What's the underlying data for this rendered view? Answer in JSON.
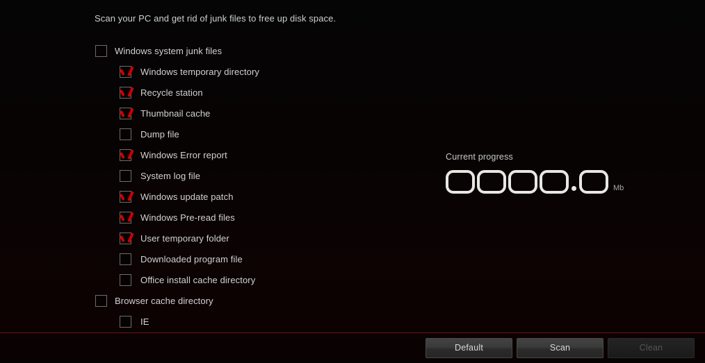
{
  "header": {
    "description": "Scan your PC and get rid of junk files to free up disk space."
  },
  "list": {
    "items": [
      {
        "label": "Windows system junk files",
        "level": 0,
        "checked": false
      },
      {
        "label": "Windows temporary directory",
        "level": 1,
        "checked": true
      },
      {
        "label": "Recycle station",
        "level": 1,
        "checked": true
      },
      {
        "label": "Thumbnail cache",
        "level": 1,
        "checked": true
      },
      {
        "label": "Dump file",
        "level": 1,
        "checked": false
      },
      {
        "label": "Windows Error report",
        "level": 1,
        "checked": true
      },
      {
        "label": "System log file",
        "level": 1,
        "checked": false
      },
      {
        "label": "Windows update patch",
        "level": 1,
        "checked": true
      },
      {
        "label": "Windows Pre-read files",
        "level": 1,
        "checked": true
      },
      {
        "label": "User temporary folder",
        "level": 1,
        "checked": true
      },
      {
        "label": "Downloaded program file",
        "level": 1,
        "checked": false
      },
      {
        "label": "Office install cache directory",
        "level": 1,
        "checked": false
      },
      {
        "label": "Browser cache directory",
        "level": 0,
        "checked": false
      },
      {
        "label": "IE",
        "level": 1,
        "checked": false
      }
    ]
  },
  "progress": {
    "title": "Current progress",
    "value": "0000.0",
    "digits": [
      "0",
      "0",
      "0",
      "0",
      "0"
    ],
    "decimal_after_index": 3,
    "unit": "Mb"
  },
  "footer": {
    "buttons": [
      {
        "id": "btn-default",
        "label": "Default",
        "enabled": true
      },
      {
        "id": "btn-scan",
        "label": "Scan",
        "enabled": true
      },
      {
        "id": "btn-clean",
        "label": "Clean",
        "enabled": false
      }
    ]
  },
  "colors": {
    "background_top": "#050505",
    "background_bottom": "#0d0202",
    "accent_red": "#cc0000",
    "separator_red": "#6e1414",
    "text_primary": "#d2d2d2",
    "digit_outline": "#e9e7e2"
  }
}
